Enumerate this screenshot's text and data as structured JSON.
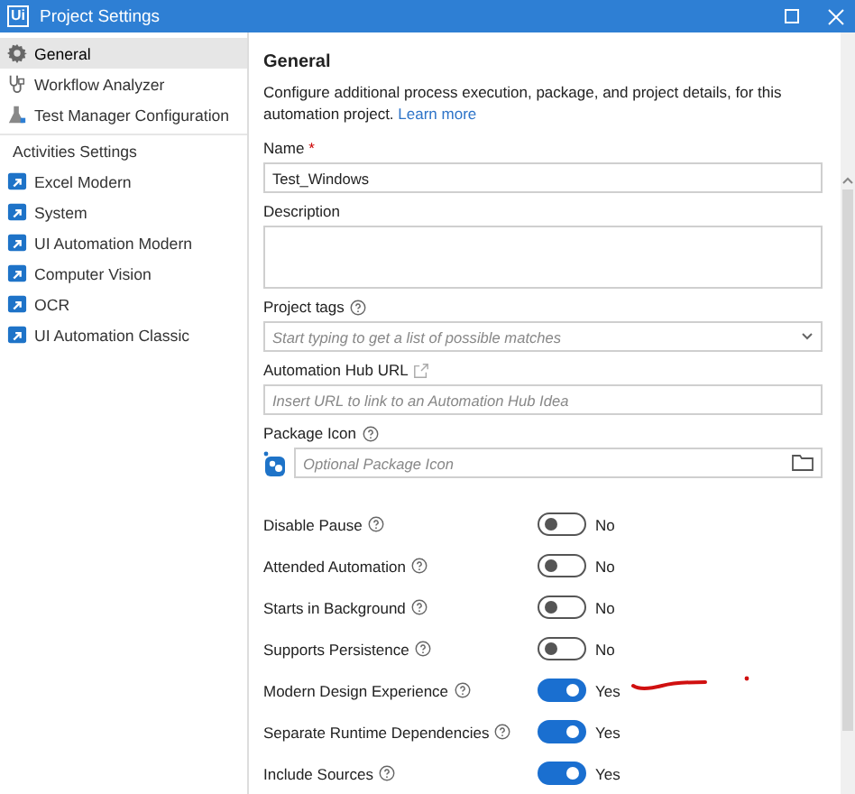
{
  "window": {
    "logo": "Ui",
    "title": "Project Settings"
  },
  "sidebar": {
    "items": [
      {
        "label": "General",
        "kind": "gear",
        "selected": true
      },
      {
        "label": "Workflow Analyzer",
        "kind": "analyzer",
        "selected": false
      },
      {
        "label": "Test Manager Configuration",
        "kind": "flask",
        "selected": false
      },
      {
        "label": "Activities Settings",
        "kind": "header"
      },
      {
        "label": "Excel Modern",
        "kind": "activity",
        "selected": false
      },
      {
        "label": "System",
        "kind": "activity",
        "selected": false
      },
      {
        "label": "UI Automation Modern",
        "kind": "activity",
        "selected": false
      },
      {
        "label": "Computer Vision",
        "kind": "activity",
        "selected": false
      },
      {
        "label": "OCR",
        "kind": "activity",
        "selected": false
      },
      {
        "label": "UI Automation Classic",
        "kind": "activity",
        "selected": false
      }
    ]
  },
  "main": {
    "heading": "General",
    "description": "Configure additional process execution, package, and project details, for this automation project.",
    "link": "Learn more",
    "fields": [
      {
        "label": "Name",
        "required_mark": "*",
        "kind": "text",
        "value": "Test_Windows"
      },
      {
        "label": "Description",
        "kind": "textarea"
      },
      {
        "label": "Project tags",
        "kind": "combo",
        "help": true,
        "placeholder": "Start typing to get a list of possible matches"
      },
      {
        "label": "Automation Hub URL",
        "kind": "url",
        "placeholder": "Insert URL to link to an Automation Hub Idea"
      },
      {
        "label": "Package Icon",
        "kind": "file",
        "help": true,
        "placeholder": "Optional Package Icon"
      }
    ],
    "toggles": [
      {
        "label": "Disable Pause",
        "on": false,
        "state": "No"
      },
      {
        "label": "Attended Automation",
        "on": false,
        "state": "No"
      },
      {
        "label": "Starts in Background",
        "on": false,
        "state": "No"
      },
      {
        "label": "Supports Persistence",
        "on": false,
        "state": "No"
      },
      {
        "label": "Modern Design Experience",
        "on": true,
        "state": "Yes"
      },
      {
        "label": "Separate Runtime Dependencies",
        "on": true,
        "state": "Yes"
      },
      {
        "label": "Include Sources",
        "on": true,
        "state": "Yes"
      }
    ]
  }
}
